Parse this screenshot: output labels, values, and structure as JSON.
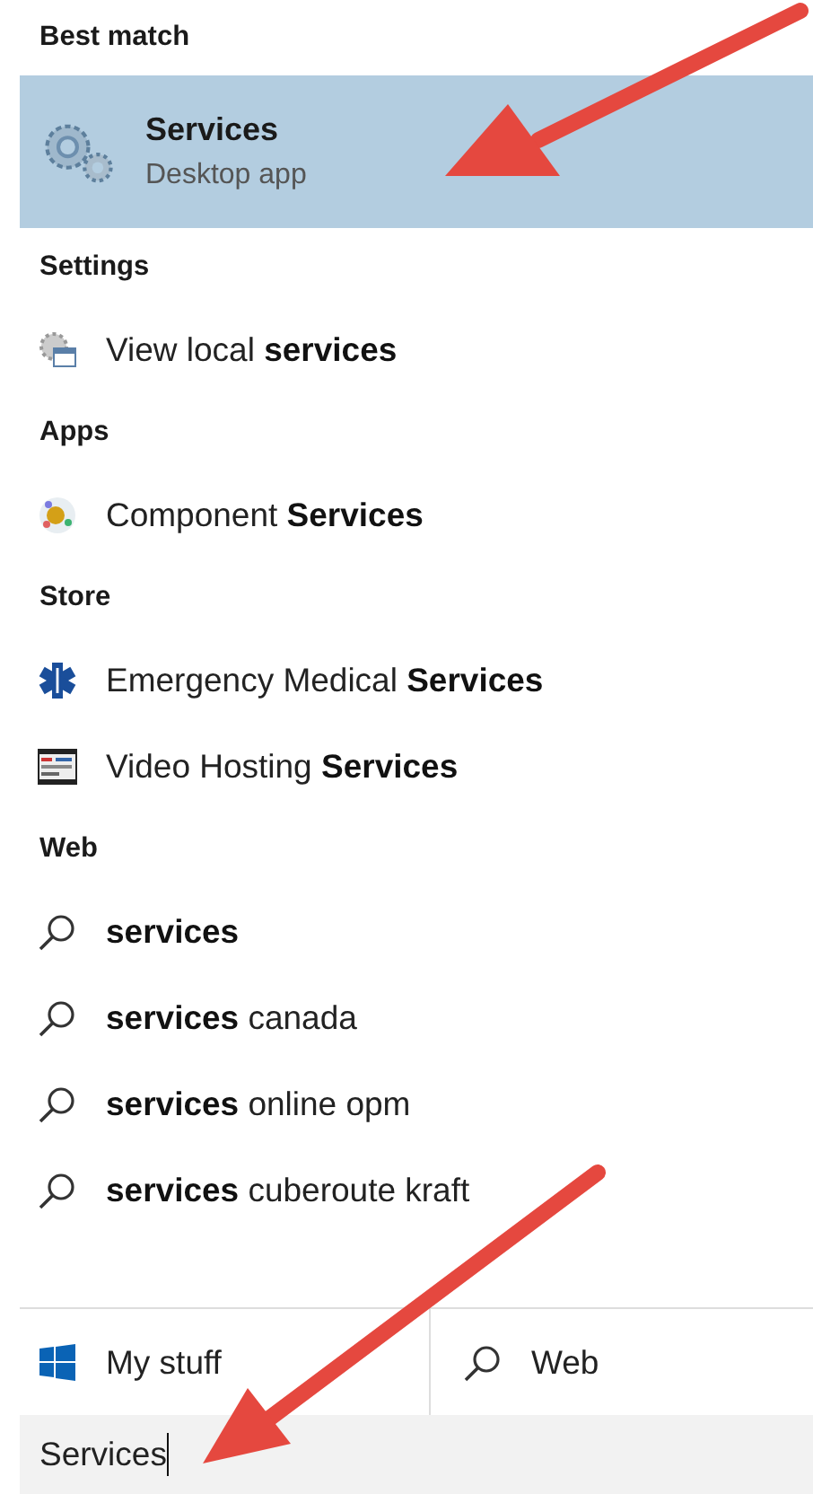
{
  "best_match": {
    "heading": "Best match",
    "item": {
      "kind": "gear",
      "title": "Services",
      "subtitle": "Desktop app",
      "selected": true
    }
  },
  "sections": [
    {
      "heading": "Settings",
      "items": [
        {
          "kind": "settings",
          "label": "View local **services**"
        }
      ]
    },
    {
      "heading": "Apps",
      "items": [
        {
          "kind": "component",
          "label": "Component **Services**"
        }
      ]
    },
    {
      "heading": "Store",
      "items": [
        {
          "kind": "medical",
          "label": "Emergency Medical **Services**"
        },
        {
          "kind": "video",
          "label": "Video Hosting **Services**"
        }
      ]
    },
    {
      "heading": "Web",
      "items": [
        {
          "kind": "search",
          "label": "**services**"
        },
        {
          "kind": "search",
          "label": "**services** canada"
        },
        {
          "kind": "search",
          "label": "**services** online opm"
        },
        {
          "kind": "search",
          "label": "**services** cuberoute kraft"
        }
      ]
    }
  ],
  "scopes": [
    {
      "kind": "windows",
      "label": "My stuff"
    },
    {
      "kind": "search",
      "label": "Web"
    }
  ],
  "search": {
    "value": "Services"
  }
}
